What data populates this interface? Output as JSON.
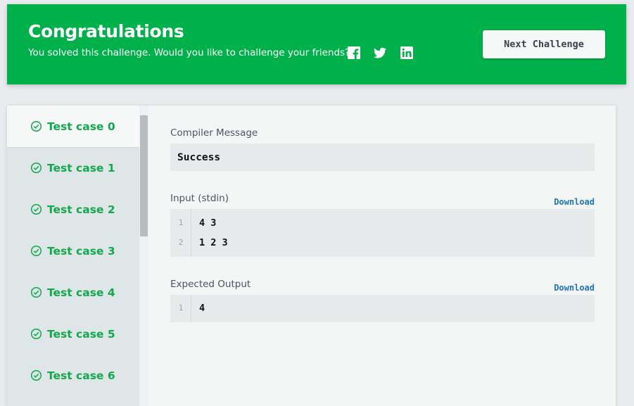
{
  "banner": {
    "title": "Congratulations",
    "subtitle": "You solved this challenge. Would you like to challenge your friends?",
    "social": [
      "facebook-icon",
      "twitter-icon",
      "linkedin-icon"
    ],
    "next_button": "Next Challenge",
    "bg_color": "#00b04a"
  },
  "sidebar": {
    "test_cases": [
      {
        "label": "Test case 0",
        "status": "passed",
        "active": true
      },
      {
        "label": "Test case 1",
        "status": "passed",
        "active": false
      },
      {
        "label": "Test case 2",
        "status": "passed",
        "active": false
      },
      {
        "label": "Test case 3",
        "status": "passed",
        "active": false
      },
      {
        "label": "Test case 4",
        "status": "passed",
        "active": false
      },
      {
        "label": "Test case 5",
        "status": "passed",
        "active": false
      },
      {
        "label": "Test case 6",
        "status": "passed",
        "active": false
      }
    ],
    "pass_color": "#13a84d"
  },
  "result": {
    "compiler_label": "Compiler Message",
    "compiler_message": "Success",
    "input_label": "Input (stdin)",
    "input_download": "Download",
    "input_lines": [
      {
        "num": "1",
        "text": "4 3"
      },
      {
        "num": "2",
        "text": "1 2 3"
      }
    ],
    "expected_label": "Expected Output",
    "expected_download": "Download",
    "expected_lines": [
      {
        "num": "1",
        "text": "4"
      }
    ]
  }
}
